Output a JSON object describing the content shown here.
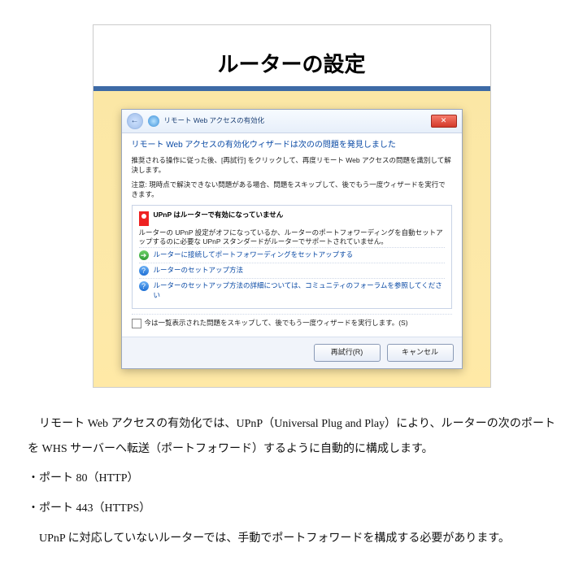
{
  "slide": {
    "title": "ルーターの設定"
  },
  "dialog": {
    "window_title": "リモート Web アクセスの有効化",
    "close_glyph": "✕",
    "back_glyph": "←",
    "heading": "リモート Web アクセスの有効化ウィザードは次のの問題を発見しました",
    "body1": "推奨される操作に従った後、[再試行] をクリックして、再度リモート Web アクセスの問題を識別して解決します。",
    "body2": "注意: 現時点で解決できない問題がある場合、問題をスキップして、後でもう一度ウィザードを実行できます。",
    "issue_title": "UPnP はルーターで有効になっていません",
    "issue_body": "ルーターの UPnP 設定がオフになっているか、ルーターのポートフォワーディングを自動セットアップするのに必要な UPnP スタンダードがルーターでサポートされていません。",
    "link1": "ルーターに接続してポートフォワーディングをセットアップする",
    "link2": "ルーターのセットアップ方法",
    "link3": "ルーターのセットアップ方法の詳細については、コミュニティのフォーラムを参照してください",
    "skip_label": "今は一覧表示された問題をスキップして、後でもう一度ウィザードを実行します。(S)",
    "retry_label": "再試行(R)",
    "cancel_label": "キャンセル"
  },
  "doc": {
    "p1": "リモート Web アクセスの有効化では、UPnP（Universal Plug and Play）により、ルーターの次のポートを WHS サーバーへ転送（ポートフォワード）するように自動的に構成します。",
    "b1": "・ポート 80（HTTP）",
    "b2": "・ポート 443（HTTPS）",
    "p2": "UPnP に対応していないルーターでは、手動でポートフォワードを構成する必要があります。"
  }
}
